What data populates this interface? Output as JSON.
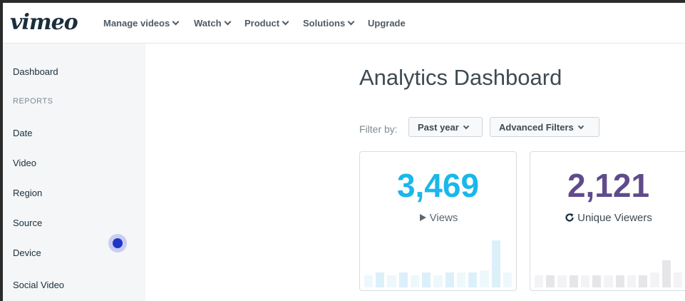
{
  "brand": {
    "logo_text": "vimeo"
  },
  "nav": {
    "items": [
      {
        "label": "Manage videos",
        "dropdown": true
      },
      {
        "label": "Watch",
        "dropdown": true
      },
      {
        "label": "Product",
        "dropdown": true
      },
      {
        "label": "Solutions",
        "dropdown": true
      },
      {
        "label": "Upgrade",
        "dropdown": false
      }
    ]
  },
  "sidebar": {
    "dashboard": "Dashboard",
    "reports_heading": "REPORTS",
    "items": [
      "Date",
      "Video",
      "Region",
      "Source",
      "Device",
      "Social Video"
    ]
  },
  "main": {
    "title": "Analytics Dashboard",
    "filter_label": "Filter by:",
    "filters": {
      "period": "Past year",
      "advanced": "Advanced Filters"
    }
  },
  "cards": [
    {
      "value": "3,469",
      "label": "Views",
      "icon": "play-icon",
      "color": "#1ab7ea",
      "spark": [
        0.25,
        0.3,
        0.25,
        0.3,
        0.25,
        0.3,
        0.25,
        0.3,
        0.3,
        0.3,
        0.35,
        0.95,
        0.3
      ]
    },
    {
      "value": "2,121",
      "label": "Unique Viewers",
      "icon": "refresh-icon",
      "color": "#5f4b8b",
      "spark": [
        0.25,
        0.25,
        0.25,
        0.25,
        0.25,
        0.25,
        0.25,
        0.25,
        0.25,
        0.25,
        0.3,
        0.55,
        0.3
      ]
    }
  ],
  "colors": {
    "accent_blue": "#1ab7ea",
    "accent_purple": "#5f4b8b",
    "pulse": "#1f37c8"
  }
}
